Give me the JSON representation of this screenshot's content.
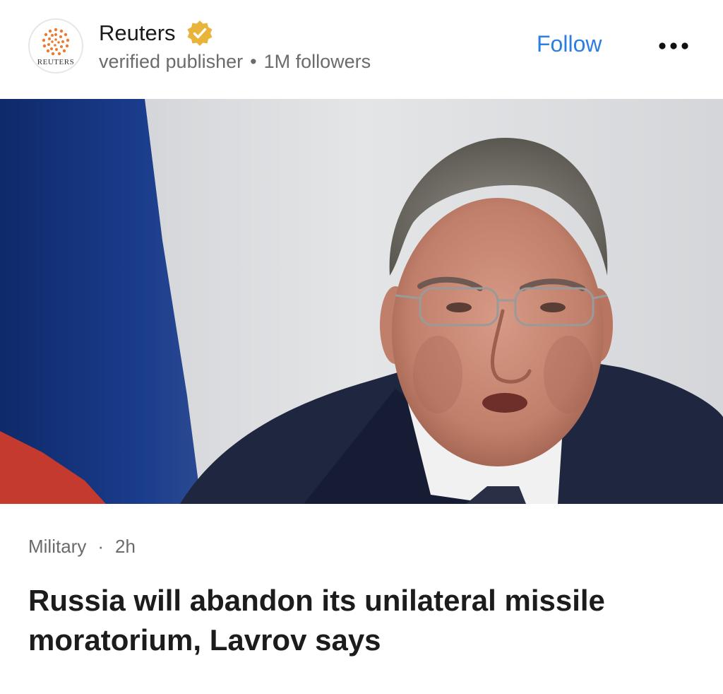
{
  "publisher": {
    "name": "Reuters",
    "logo_text": "REUTERS",
    "badge_icon": "verified-check-icon",
    "status": "verified publisher",
    "separator": "•",
    "followers": "1M followers",
    "follow_label": "Follow",
    "more_icon": "more-dots-icon"
  },
  "article": {
    "category": "Military",
    "separator": "·",
    "time": "2h",
    "headline": "Russia will abandon its unilateral missile moratorium, Lavrov says"
  },
  "colors": {
    "accent": "#2a7fe0",
    "logo_orange": "#ee7a2f",
    "badge_gold": "#e8b53a"
  }
}
